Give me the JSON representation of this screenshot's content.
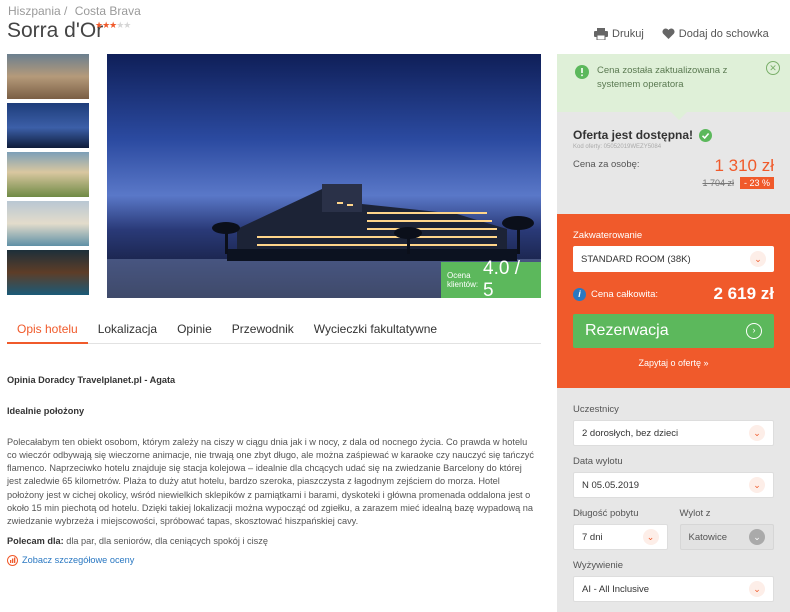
{
  "breadcrumb": [
    "Hiszpania /",
    "Costa Brava"
  ],
  "hotel": {
    "name": "Sorra d'Or",
    "stars_filled": "★★★",
    "stars_empty": "★★"
  },
  "actions": {
    "print": "Drukuj",
    "save": "Dodaj do schowka"
  },
  "gallery": {
    "rating_label": "Ocena klientów:",
    "rating_value": "4.0 / 5"
  },
  "tabs": [
    "Opis hotelu",
    "Lokalizacja",
    "Opinie",
    "Przewodnik",
    "Wycieczki fakultatywne"
  ],
  "description": {
    "author": "Opinia Doradcy Travelplanet.pl - Agata",
    "subheading": "Idealnie położony",
    "body": "Polecałabym ten obiekt osobom, którym zależy na ciszy w ciągu dnia jak i w nocy, z dala od nocnego życia. Co prawda w hotelu co wieczór odbywają się wieczorne animacje, nie trwają one zbyt długo, ale można zaśpiewać w karaoke czy nauczyć się tańczyć flamenco. Naprzeciwko hotelu znajduje się stacja kolejowa – idealnie dla chcących udać się na zwiedzanie Barcelony do której jest zaledwie 65 kilometrów. Plaża to duży atut hotelu, bardzo szeroka, piaszczysta z łagodnym zejściem do morza. Hotel położony jest w cichej okolicy, wśród niewielkich sklepików z pamiątkami i barami, dyskoteki i główna promenada oddalona jest o około 15 min piechotą od hotelu. Dzięki takiej lokalizacji można wypocząć od zgiełku, a zarazem mieć idealną bazę wypadową na zwiedzanie wybrzeża i miejscowości, spróbować tapas, skosztować hiszpańskiej cavy.",
    "recommend_label": "Polecam dla:",
    "recommend_value": " dla par, dla seniorów, dla ceniących spokój i ciszę",
    "ratings_link": "Zobacz szczegółowe oceny"
  },
  "notice": {
    "text": "Cena została zaktualizowana z systemem operatora"
  },
  "offer": {
    "title": "Oferta jest dostępna!",
    "code": "Kod oferty: 05052019WEZY5084",
    "price_label": "Cena za osobę:",
    "price": "1 310 zł",
    "old_price": "1 704 zł",
    "discount": "- 23 %"
  },
  "booking": {
    "accommodation_label": "Zakwaterowanie",
    "accommodation_value": "STANDARD ROOM (38K)",
    "total_label": "Cena całkowita:",
    "total_value": "2 619 zł",
    "reserve": "Rezerwacja",
    "ask": "Zapytaj o ofertę »"
  },
  "filters": {
    "participants_label": "Uczestnicy",
    "participants_value": "2 dorosłych, bez dzieci",
    "departure_label": "Data wylotu",
    "departure_value": "N 05.05.2019",
    "duration_label": "Długość pobytu",
    "duration_value": "7 dni",
    "from_label": "Wylot z",
    "from_value": "Katowice",
    "board_label": "Wyżywienie",
    "board_value": "AI - All Inclusive"
  },
  "colors": {
    "accent": "#f05a2b",
    "success": "#5cb85c",
    "link": "#2a78c2"
  }
}
